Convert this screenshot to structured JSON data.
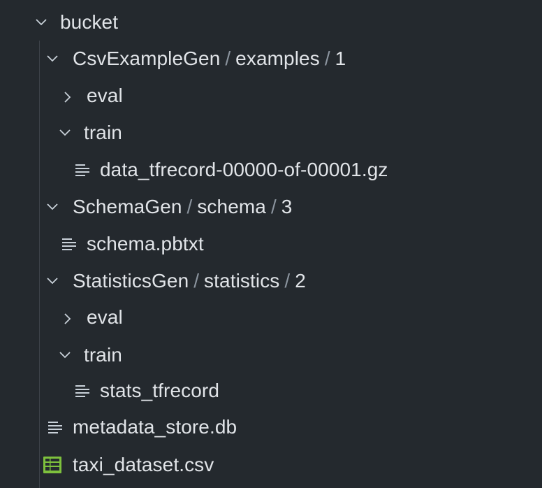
{
  "explorer": {
    "root": {
      "label": "bucket",
      "expanded": true
    },
    "csvexamplegen": {
      "parts": [
        "CsvExampleGen",
        "examples",
        "1"
      ],
      "separator": "/",
      "expanded": true,
      "eval": {
        "label": "eval",
        "expanded": false
      },
      "train": {
        "label": "train",
        "expanded": true
      },
      "file": {
        "label": "data_tfrecord-00000-of-00001.gz",
        "icon": "file-lines-icon"
      }
    },
    "schemagen": {
      "parts": [
        "SchemaGen",
        "schema",
        "3"
      ],
      "separator": "/",
      "expanded": true,
      "file": {
        "label": "schema.pbtxt",
        "icon": "file-lines-icon"
      }
    },
    "statisticsgen": {
      "parts": [
        "StatisticsGen",
        "statistics",
        "2"
      ],
      "separator": "/",
      "expanded": true,
      "eval": {
        "label": "eval",
        "expanded": false
      },
      "train": {
        "label": "train",
        "expanded": true
      },
      "file": {
        "label": "stats_tfrecord",
        "icon": "file-lines-icon"
      }
    },
    "metadata": {
      "label": "metadata_store.db",
      "icon": "file-lines-icon"
    },
    "taxi": {
      "label": "taxi_dataset.csv",
      "icon": "spreadsheet-icon",
      "icon_color": "#7ec13d"
    }
  },
  "colors": {
    "background": "#24292e",
    "text": "#e1e4e8",
    "separator": "#8b949e",
    "icon": "#c9d1d9",
    "guide": "#3c4148"
  }
}
